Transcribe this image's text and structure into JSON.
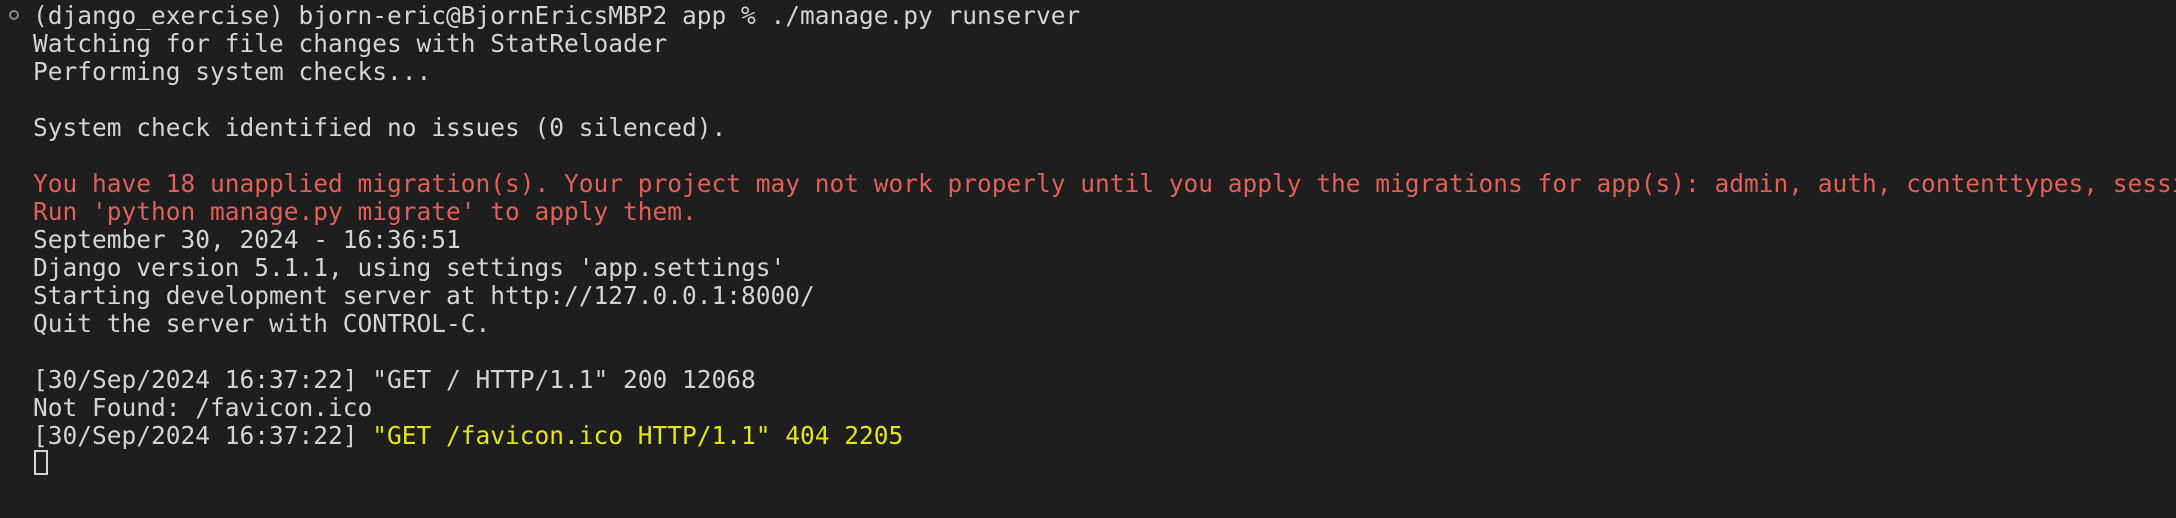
{
  "colors": {
    "background": "#1e1e1e",
    "foreground": "#d4d4d4",
    "warning_red": "#e0605a",
    "highlight_yellow": "#e5e510"
  },
  "prompt": {
    "icon": "circle-status-icon",
    "text": "(django_exercise) bjorn-eric@BjornEricsMBP2 app % ./manage.py runserver"
  },
  "output": {
    "watching": "Watching for file changes with StatReloader",
    "checks": "Performing system checks...",
    "check_result": "System check identified no issues (0 silenced).",
    "migration_warning_1": "You have 18 unapplied migration(s). Your project may not work properly until you apply the migrations for app(s): admin, auth, contenttypes, sessions.",
    "migration_warning_2": "Run 'python manage.py migrate' to apply them.",
    "datetime": "September 30, 2024 - 16:36:51",
    "django_version": "Django version 5.1.1, using settings 'app.settings'",
    "server_start": "Starting development server at http://127.0.0.1:8000/",
    "quit_hint": "Quit the server with CONTROL-C.",
    "log_1": "[30/Sep/2024 16:37:22] \"GET / HTTP/1.1\" 200 12068",
    "not_found": "Not Found: /favicon.ico",
    "log_2_prefix": "[30/Sep/2024 16:37:22] ",
    "log_2_request": "\"GET /favicon.ico HTTP/1.1\" 404 2205"
  }
}
